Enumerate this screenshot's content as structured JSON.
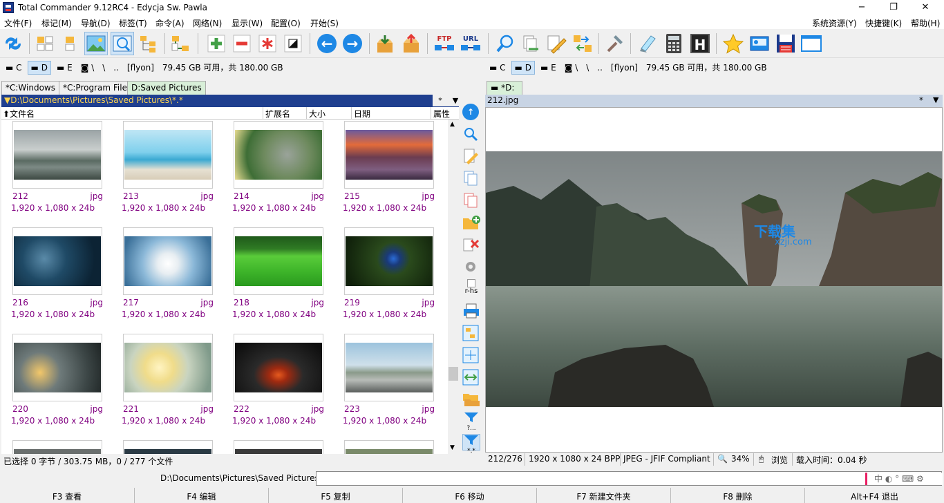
{
  "window": {
    "title": "Total Commander 9.12RC4 - Edycja Sw. Pawla",
    "minimize": "−",
    "restore": "❐",
    "close": "✕"
  },
  "menu": {
    "left": [
      "文件(F)",
      "标记(M)",
      "导航(D)",
      "标签(T)",
      "命令(A)",
      "网络(N)",
      "显示(W)",
      "配置(O)",
      "开始(S)"
    ],
    "right": [
      "系统资源(Y)",
      "快捷键(K)",
      "帮助(H)"
    ]
  },
  "toolbar": {
    "ftp_label": "FTP",
    "url_label": "URL",
    "h_label": "H"
  },
  "left_drives": {
    "c": "C",
    "d": "D",
    "e": "E",
    "net": "\\",
    "up": "..",
    "label": "[flyon]",
    "space": "79.45 GB 可用，共 180.00 GB"
  },
  "right_drives": {
    "c": "C",
    "d": "D",
    "e": "E",
    "net": "\\",
    "up": "..",
    "label": "[flyon]",
    "space": "79.45 GB 可用，共 180.00 GB"
  },
  "left_tabs": [
    "*C:Windows",
    "*C:Program Files",
    "D:Saved Pictures"
  ],
  "left_path": "▼D:\\Documents\\Pictures\\Saved Pictures\\*.*",
  "path_buttons": {
    "star": "*",
    "down": "▼"
  },
  "columns": {
    "name": "⬆文件名",
    "ext": "扩展名",
    "size": "大小",
    "date": "日期",
    "attr": "属性"
  },
  "files": [
    {
      "name": "212",
      "ext": "jpg",
      "dim": "1,920 x 1,080 x 24b"
    },
    {
      "name": "213",
      "ext": "jpg",
      "dim": "1,920 x 1,080 x 24b"
    },
    {
      "name": "214",
      "ext": "jpg",
      "dim": "1,920 x 1,080 x 24b"
    },
    {
      "name": "215",
      "ext": "jpg",
      "dim": "1,920 x 1,080 x 24b"
    },
    {
      "name": "216",
      "ext": "jpg",
      "dim": "1,920 x 1,080 x 24b"
    },
    {
      "name": "217",
      "ext": "jpg",
      "dim": "1,920 x 1,080 x 24b"
    },
    {
      "name": "218",
      "ext": "jpg",
      "dim": "1,920 x 1,080 x 24b"
    },
    {
      "name": "219",
      "ext": "jpg",
      "dim": "1,920 x 1,080 x 24b"
    },
    {
      "name": "220",
      "ext": "jpg",
      "dim": "1,920 x 1,080 x 24b"
    },
    {
      "name": "221",
      "ext": "jpg",
      "dim": "1,920 x 1,080 x 24b"
    },
    {
      "name": "222",
      "ext": "jpg",
      "dim": "1,920 x 1,080 x 24b"
    },
    {
      "name": "223",
      "ext": "jpg",
      "dim": "1,920 x 1,080 x 24b"
    }
  ],
  "left_status": "已选择 0 字节 / 303.75 MB，0 / 277 个文件",
  "mid_label": "r-hs",
  "right_tab": "*D:",
  "right_file": "212.jpg",
  "watermark": {
    "text": "下载集",
    "sub": "xzji.com"
  },
  "right_status": {
    "index": "212/276",
    "dims": "1920 x 1080 x 24 BPP",
    "format": "JPEG - JFIF Compliant",
    "zoom": "34%",
    "browse": "浏览",
    "load": "载入时间：0.04 秒"
  },
  "cmd_path": "D:\\Documents\\Pictures\\Saved Pictures>",
  "ime": "中 ◐ ° ⌨ ⚙",
  "fkeys": [
    "F3 查看",
    "F4 编辑",
    "F5 复制",
    "F6 移动",
    "F7 新建文件夹",
    "F8 删除",
    "Alt+F4 退出"
  ]
}
